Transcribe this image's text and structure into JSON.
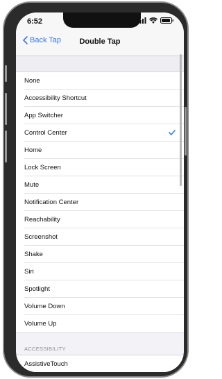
{
  "status_bar": {
    "time": "6:52"
  },
  "nav": {
    "back_label": "Back Tap",
    "title": "Double Tap"
  },
  "options": [
    {
      "label": "None",
      "selected": false
    },
    {
      "label": "Accessibility Shortcut",
      "selected": false
    },
    {
      "label": "App Switcher",
      "selected": false
    },
    {
      "label": "Control Center",
      "selected": true
    },
    {
      "label": "Home",
      "selected": false
    },
    {
      "label": "Lock Screen",
      "selected": false
    },
    {
      "label": "Mute",
      "selected": false
    },
    {
      "label": "Notification Center",
      "selected": false
    },
    {
      "label": "Reachability",
      "selected": false
    },
    {
      "label": "Screenshot",
      "selected": false
    },
    {
      "label": "Shake",
      "selected": false
    },
    {
      "label": "Siri",
      "selected": false
    },
    {
      "label": "Spotlight",
      "selected": false
    },
    {
      "label": "Volume Down",
      "selected": false
    },
    {
      "label": "Volume Up",
      "selected": false
    }
  ],
  "accessibility_section": {
    "header": "ACCESSIBILITY",
    "items": [
      {
        "label": "AssistiveTouch"
      }
    ]
  },
  "colors": {
    "accent": "#3478f6",
    "background": "#f2f2f7"
  }
}
